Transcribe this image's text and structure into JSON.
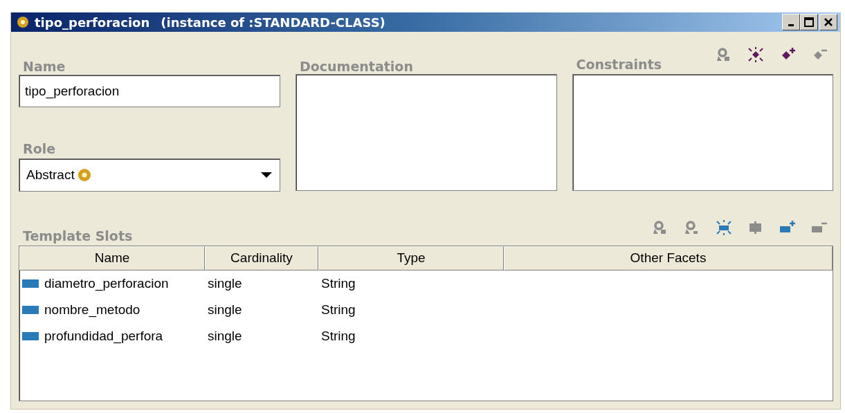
{
  "window": {
    "title": "tipo_perforacion",
    "subtitle": "(instance of :STANDARD-CLASS)"
  },
  "name_field": {
    "label": "Name",
    "value": "tipo_perforacion"
  },
  "role": {
    "label": "Role",
    "value": "Abstract"
  },
  "documentation": {
    "label": "Documentation"
  },
  "constraints": {
    "label": "Constraints",
    "tools": [
      {
        "kind": "view",
        "disabled": true
      },
      {
        "kind": "create",
        "disabled": false
      },
      {
        "kind": "add",
        "disabled": false
      },
      {
        "kind": "remove",
        "disabled": true
      }
    ]
  },
  "template_slots": {
    "label": "Template Slots",
    "tools": [
      {
        "kind": "view",
        "disabled": true
      },
      {
        "kind": "view-top",
        "disabled": true
      },
      {
        "kind": "create",
        "disabled": false
      },
      {
        "kind": "override",
        "disabled": true
      },
      {
        "kind": "add",
        "disabled": false
      },
      {
        "kind": "remove",
        "disabled": true
      }
    ],
    "columns": [
      "Name",
      "Cardinality",
      "Type",
      "Other Facets"
    ],
    "rows": [
      {
        "name": "diametro_perforacion",
        "cardinality": "single",
        "type": "String"
      },
      {
        "name": "nombre_metodo",
        "cardinality": "single",
        "type": "String"
      },
      {
        "name": "profundidad_perfora",
        "cardinality": "single",
        "type": "String"
      }
    ]
  }
}
